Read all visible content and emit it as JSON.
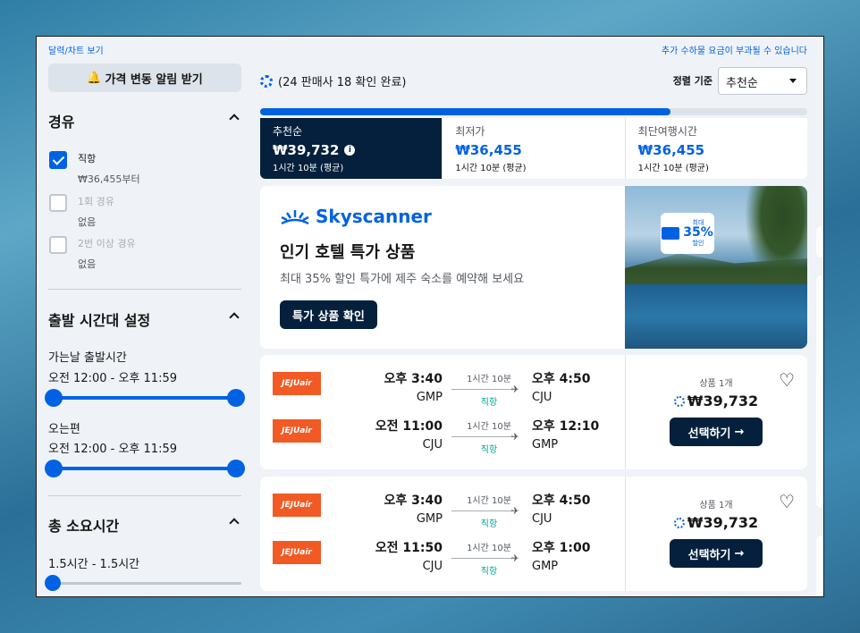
{
  "top": {
    "link": "달력/차트 보기",
    "notice": "추가 수하물 요금이 부과될 수 있습니다"
  },
  "sidebar": {
    "alert_button": "가격 변동 알림 받기",
    "stops": {
      "title": "경유",
      "options": [
        {
          "label": "직항",
          "sub": "₩36,455부터",
          "checked": true
        },
        {
          "label": "1회 경유",
          "sub": "없음",
          "checked": false
        },
        {
          "label": "2번 이상 경유",
          "sub": "없음",
          "checked": false
        }
      ]
    },
    "departure": {
      "title": "출발 시간대 설정",
      "outbound_label": "가는날 출발시간",
      "outbound_range": "오전 12:00 - 오후 11:59",
      "return_label": "오는편",
      "return_range": "오전 12:00 - 오후 11:59"
    },
    "duration": {
      "title": "총 소요시간",
      "range": "1.5시간 - 1.5시간"
    }
  },
  "main": {
    "progress_text": "(24 판매사 18 확인 완료)",
    "progress_fraction": 0.75,
    "sort_label": "정렬 기준",
    "sort_value": "추천순",
    "tabs": [
      {
        "title": "추천순",
        "price": "₩39,732",
        "duration": "1시간 10분 (평균)",
        "active": true
      },
      {
        "title": "최저가",
        "price": "₩36,455",
        "duration": "1시간 10분 (평균)",
        "active": false
      },
      {
        "title": "최단여행시간",
        "price": "₩36,455",
        "duration": "1시간 10분 (평균)",
        "active": false
      }
    ],
    "promo": {
      "brand": "Skyscanner",
      "title": "인기 호텔 특가 상품",
      "subtitle": "최대 35% 할인 특가에 제주 숙소를 예약해 보세요",
      "cta": "특가 상품 확인",
      "badge_top": "최대",
      "badge_big": "35%",
      "badge_bottom": "할인"
    },
    "results": [
      {
        "legs": [
          {
            "airline": "JEJUair",
            "dep_time": "오후 3:40",
            "dep_ap": "GMP",
            "duration": "1시간 10분",
            "stops": "직항",
            "arr_time": "오후 4:50",
            "arr_ap": "CJU"
          },
          {
            "airline": "JEJUair",
            "dep_time": "오전 11:00",
            "dep_ap": "CJU",
            "duration": "1시간 10분",
            "stops": "직항",
            "arr_time": "오후 12:10",
            "arr_ap": "GMP"
          }
        ],
        "deal_count": "상품 1개",
        "price": "₩39,732",
        "select": "선택하기"
      },
      {
        "legs": [
          {
            "airline": "JEJUair",
            "dep_time": "오후 3:40",
            "dep_ap": "GMP",
            "duration": "1시간 10분",
            "stops": "직항",
            "arr_time": "오후 4:50",
            "arr_ap": "CJU"
          },
          {
            "airline": "JEJUair",
            "dep_time": "오전 11:50",
            "dep_ap": "CJU",
            "duration": "1시간 10분",
            "stops": "직항",
            "arr_time": "오후 1:00",
            "arr_ap": "GMP"
          }
        ],
        "deal_count": "상품 1개",
        "price": "₩39,732",
        "select": "선택하기"
      }
    ]
  },
  "colors": {
    "accent": "#0062e3",
    "dark": "#05203c",
    "airline": "#f15a24",
    "direct": "#00a698"
  }
}
